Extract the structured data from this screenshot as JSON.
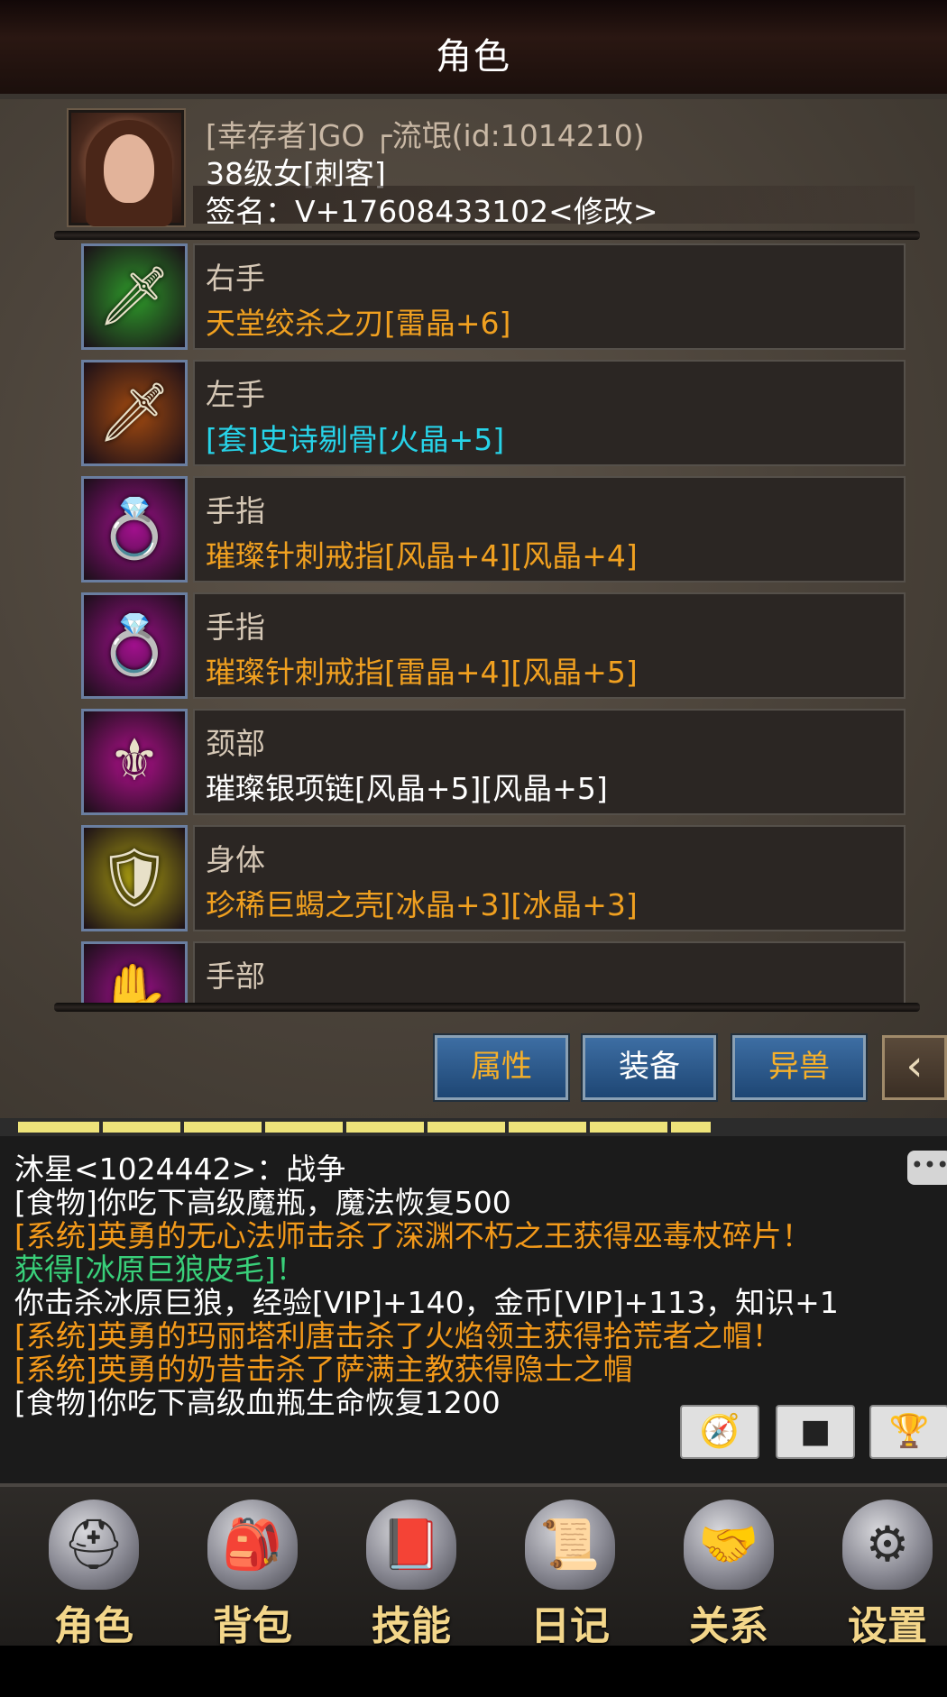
{
  "header": {
    "title": "角色"
  },
  "profile": {
    "name": "[幸存者]GO ┌流氓(id:1014210)",
    "level": "38级女[刺客]",
    "signature": "签名：V+17608433102<修改>"
  },
  "equipment": [
    {
      "slot": "右手",
      "item": "天堂绞杀之刃[雷晶+6]",
      "item_color": "#f0a020",
      "icon": "blade-icon",
      "icon_bg": "#2e9a2a",
      "glyph": "🗡"
    },
    {
      "slot": "左手",
      "item": "[套]史诗剔骨[火晶+5]",
      "item_color": "#27d3e8",
      "icon": "dagger-icon",
      "icon_bg": "#a24a10",
      "glyph": "🗡"
    },
    {
      "slot": "手指",
      "item": "璀璨针刺戒指[风晶+4][风晶+4]",
      "item_color": "#f0a020",
      "icon": "ring-icon",
      "icon_bg": "#a0108c",
      "glyph": "💍"
    },
    {
      "slot": "手指",
      "item": "璀璨针刺戒指[雷晶+4][风晶+5]",
      "item_color": "#f0a020",
      "icon": "ring-icon",
      "icon_bg": "#a0108c",
      "glyph": "💍"
    },
    {
      "slot": "颈部",
      "item": "璀璨银项链[风晶+5][风晶+5]",
      "item_color": "#ffffff",
      "icon": "necklace-icon",
      "icon_bg": "#b0108c",
      "glyph": "⚜"
    },
    {
      "slot": "身体",
      "item": "珍稀巨蝎之壳[冰晶+3][冰晶+3]",
      "item_color": "#f0a020",
      "icon": "armor-icon",
      "icon_bg": "#a89c10",
      "glyph": "🛡"
    },
    {
      "slot": "手部",
      "item": "",
      "item_color": "#f0a020",
      "icon": "glove-icon",
      "icon_bg": "#a0108c",
      "glyph": "✋"
    }
  ],
  "tabs": [
    {
      "label": "属性",
      "color": "#f6b02a"
    },
    {
      "label": "装备",
      "color": "#ffffff"
    },
    {
      "label": "异兽",
      "color": "#f6b02a"
    }
  ],
  "progress": {
    "fraction": 0.76
  },
  "chat": [
    {
      "text": "沐星<1024442>：战争",
      "color": "#ffffff"
    },
    {
      "text": "[食物]你吃下高级魔瓶，魔法恢复500",
      "color": "#ffffff"
    },
    {
      "text": "[系统]英勇的无心法师击杀了深渊不朽之王获得巫毒杖碎片！",
      "color": "#f49a1a"
    },
    {
      "text": "获得[冰原巨狼皮毛]！",
      "color": "#39d07a"
    },
    {
      "text": "你击杀冰原巨狼，经验[VIP]+140，金币[VIP]+113，知识+1",
      "color": "#ffffff"
    },
    {
      "text": "[系统]英勇的玛丽塔利唐击杀了火焰领主获得拾荒者之帽！",
      "color": "#f49a1a"
    },
    {
      "text": "[系统]英勇的奶昔击杀了萨满主教获得隐士之帽",
      "color": "#f49a1a"
    },
    {
      "text": "[食物]你吃下高级血瓶生命恢复1200",
      "color": "#ffffff"
    }
  ],
  "nav": [
    {
      "label": "角色",
      "icon": "helmet-icon",
      "glyph": "⛑"
    },
    {
      "label": "背包",
      "icon": "backpack-icon",
      "glyph": "🎒"
    },
    {
      "label": "技能",
      "icon": "skill-book-icon",
      "glyph": "📕"
    },
    {
      "label": "日记",
      "icon": "scroll-icon",
      "glyph": "📜"
    },
    {
      "label": "关系",
      "icon": "handshake-icon",
      "glyph": "🤝"
    },
    {
      "label": "设置",
      "icon": "gear-icon",
      "glyph": "⚙"
    }
  ]
}
